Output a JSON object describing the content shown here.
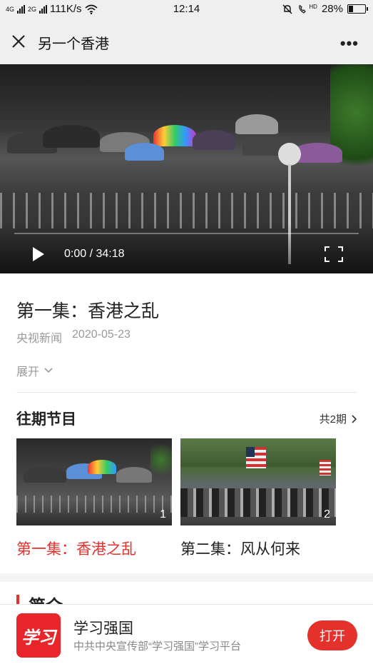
{
  "status_bar": {
    "signal_left": "4G",
    "signal_right": "2G",
    "network_speed": "111K/s",
    "time": "12:14",
    "hd_label": "HD",
    "battery": "28%",
    "battery_level": 0.28
  },
  "nav": {
    "title": "另一个香港",
    "close_icon": "close-icon",
    "more_icon": "more-dots-icon",
    "more_label": "•••"
  },
  "video": {
    "current_time": "0:00",
    "duration": "34:18",
    "time_display": "0:00 / 34:18",
    "progress": 0
  },
  "episode": {
    "title": "第一集：香港之乱",
    "source": "央视新闻",
    "date": "2020-05-23",
    "expand_label": "展开"
  },
  "past": {
    "title": "往期节目",
    "count_label": "共2期",
    "items": [
      {
        "number": "1",
        "label": "第一集：香港之乱",
        "active": true
      },
      {
        "number": "2",
        "label": "第二集：风从何来",
        "active": false
      }
    ]
  },
  "intro": {
    "title": "简介"
  },
  "banner": {
    "logo_text": "学习",
    "app_name": "学习强国",
    "description": "中共中央宣传部“学习强国”学习平台",
    "open_label": "打开"
  },
  "colors": {
    "accent": "#e4312b",
    "muted": "#999999"
  }
}
